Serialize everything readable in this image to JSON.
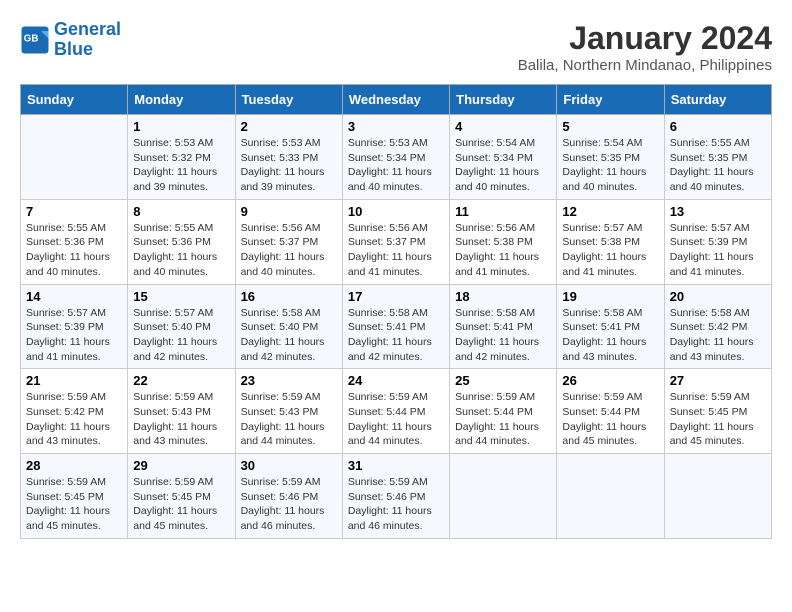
{
  "header": {
    "logo_line1": "General",
    "logo_line2": "Blue",
    "title": "January 2024",
    "subtitle": "Balila, Northern Mindanao, Philippines"
  },
  "columns": [
    "Sunday",
    "Monday",
    "Tuesday",
    "Wednesday",
    "Thursday",
    "Friday",
    "Saturday"
  ],
  "weeks": [
    [
      {
        "day": "",
        "detail": ""
      },
      {
        "day": "1",
        "detail": "Sunrise: 5:53 AM\nSunset: 5:32 PM\nDaylight: 11 hours\nand 39 minutes."
      },
      {
        "day": "2",
        "detail": "Sunrise: 5:53 AM\nSunset: 5:33 PM\nDaylight: 11 hours\nand 39 minutes."
      },
      {
        "day": "3",
        "detail": "Sunrise: 5:53 AM\nSunset: 5:34 PM\nDaylight: 11 hours\nand 40 minutes."
      },
      {
        "day": "4",
        "detail": "Sunrise: 5:54 AM\nSunset: 5:34 PM\nDaylight: 11 hours\nand 40 minutes."
      },
      {
        "day": "5",
        "detail": "Sunrise: 5:54 AM\nSunset: 5:35 PM\nDaylight: 11 hours\nand 40 minutes."
      },
      {
        "day": "6",
        "detail": "Sunrise: 5:55 AM\nSunset: 5:35 PM\nDaylight: 11 hours\nand 40 minutes."
      }
    ],
    [
      {
        "day": "7",
        "detail": "Sunrise: 5:55 AM\nSunset: 5:36 PM\nDaylight: 11 hours\nand 40 minutes."
      },
      {
        "day": "8",
        "detail": "Sunrise: 5:55 AM\nSunset: 5:36 PM\nDaylight: 11 hours\nand 40 minutes."
      },
      {
        "day": "9",
        "detail": "Sunrise: 5:56 AM\nSunset: 5:37 PM\nDaylight: 11 hours\nand 40 minutes."
      },
      {
        "day": "10",
        "detail": "Sunrise: 5:56 AM\nSunset: 5:37 PM\nDaylight: 11 hours\nand 41 minutes."
      },
      {
        "day": "11",
        "detail": "Sunrise: 5:56 AM\nSunset: 5:38 PM\nDaylight: 11 hours\nand 41 minutes."
      },
      {
        "day": "12",
        "detail": "Sunrise: 5:57 AM\nSunset: 5:38 PM\nDaylight: 11 hours\nand 41 minutes."
      },
      {
        "day": "13",
        "detail": "Sunrise: 5:57 AM\nSunset: 5:39 PM\nDaylight: 11 hours\nand 41 minutes."
      }
    ],
    [
      {
        "day": "14",
        "detail": "Sunrise: 5:57 AM\nSunset: 5:39 PM\nDaylight: 11 hours\nand 41 minutes."
      },
      {
        "day": "15",
        "detail": "Sunrise: 5:57 AM\nSunset: 5:40 PM\nDaylight: 11 hours\nand 42 minutes."
      },
      {
        "day": "16",
        "detail": "Sunrise: 5:58 AM\nSunset: 5:40 PM\nDaylight: 11 hours\nand 42 minutes."
      },
      {
        "day": "17",
        "detail": "Sunrise: 5:58 AM\nSunset: 5:41 PM\nDaylight: 11 hours\nand 42 minutes."
      },
      {
        "day": "18",
        "detail": "Sunrise: 5:58 AM\nSunset: 5:41 PM\nDaylight: 11 hours\nand 42 minutes."
      },
      {
        "day": "19",
        "detail": "Sunrise: 5:58 AM\nSunset: 5:41 PM\nDaylight: 11 hours\nand 43 minutes."
      },
      {
        "day": "20",
        "detail": "Sunrise: 5:58 AM\nSunset: 5:42 PM\nDaylight: 11 hours\nand 43 minutes."
      }
    ],
    [
      {
        "day": "21",
        "detail": "Sunrise: 5:59 AM\nSunset: 5:42 PM\nDaylight: 11 hours\nand 43 minutes."
      },
      {
        "day": "22",
        "detail": "Sunrise: 5:59 AM\nSunset: 5:43 PM\nDaylight: 11 hours\nand 43 minutes."
      },
      {
        "day": "23",
        "detail": "Sunrise: 5:59 AM\nSunset: 5:43 PM\nDaylight: 11 hours\nand 44 minutes."
      },
      {
        "day": "24",
        "detail": "Sunrise: 5:59 AM\nSunset: 5:44 PM\nDaylight: 11 hours\nand 44 minutes."
      },
      {
        "day": "25",
        "detail": "Sunrise: 5:59 AM\nSunset: 5:44 PM\nDaylight: 11 hours\nand 44 minutes."
      },
      {
        "day": "26",
        "detail": "Sunrise: 5:59 AM\nSunset: 5:44 PM\nDaylight: 11 hours\nand 45 minutes."
      },
      {
        "day": "27",
        "detail": "Sunrise: 5:59 AM\nSunset: 5:45 PM\nDaylight: 11 hours\nand 45 minutes."
      }
    ],
    [
      {
        "day": "28",
        "detail": "Sunrise: 5:59 AM\nSunset: 5:45 PM\nDaylight: 11 hours\nand 45 minutes."
      },
      {
        "day": "29",
        "detail": "Sunrise: 5:59 AM\nSunset: 5:45 PM\nDaylight: 11 hours\nand 45 minutes."
      },
      {
        "day": "30",
        "detail": "Sunrise: 5:59 AM\nSunset: 5:46 PM\nDaylight: 11 hours\nand 46 minutes."
      },
      {
        "day": "31",
        "detail": "Sunrise: 5:59 AM\nSunset: 5:46 PM\nDaylight: 11 hours\nand 46 minutes."
      },
      {
        "day": "",
        "detail": ""
      },
      {
        "day": "",
        "detail": ""
      },
      {
        "day": "",
        "detail": ""
      }
    ]
  ]
}
